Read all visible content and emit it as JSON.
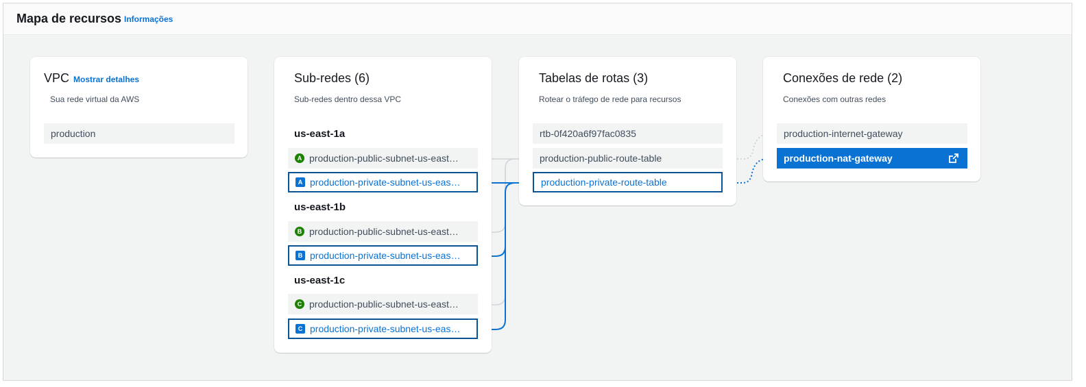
{
  "header": {
    "title": "Mapa de recursos",
    "info_link": "Informações"
  },
  "vpc": {
    "title": "VPC",
    "details_link": "Mostrar detalhes",
    "description": "Sua rede virtual da AWS",
    "items": [
      "production"
    ]
  },
  "subnets": {
    "title": "Sub-redes (6)",
    "description": "Sub-redes dentro dessa VPC",
    "zones": [
      {
        "name": "us-east-1a",
        "items": [
          {
            "label": "production-public-subnet-us-east…",
            "badge": "A",
            "type": "public"
          },
          {
            "label": "production-private-subnet-us-eas…",
            "badge": "A",
            "type": "private"
          }
        ]
      },
      {
        "name": "us-east-1b",
        "items": [
          {
            "label": "production-public-subnet-us-east…",
            "badge": "B",
            "type": "public"
          },
          {
            "label": "production-private-subnet-us-eas…",
            "badge": "B",
            "type": "private"
          }
        ]
      },
      {
        "name": "us-east-1c",
        "items": [
          {
            "label": "production-public-subnet-us-east…",
            "badge": "C",
            "type": "public"
          },
          {
            "label": "production-private-subnet-us-eas…",
            "badge": "C",
            "type": "private"
          }
        ]
      }
    ]
  },
  "route_tables": {
    "title": "Tabelas de rotas (3)",
    "description": "Rotear o tráfego de rede para recursos",
    "items": [
      "rtb-0f420a6f97fac0835",
      "production-public-route-table",
      "production-private-route-table"
    ]
  },
  "connections": {
    "title": "Conexões de rede (2)",
    "description": "Conexões com outras redes",
    "items": [
      "production-internet-gateway",
      "production-nat-gateway"
    ],
    "nat_icon": "external-link-icon"
  },
  "colors": {
    "selected_border": "#0a5496",
    "link": "#0972d3",
    "public_badge": "#1d8102",
    "connector_active": "#0972d3",
    "connector_inactive": "#d1d5db"
  }
}
